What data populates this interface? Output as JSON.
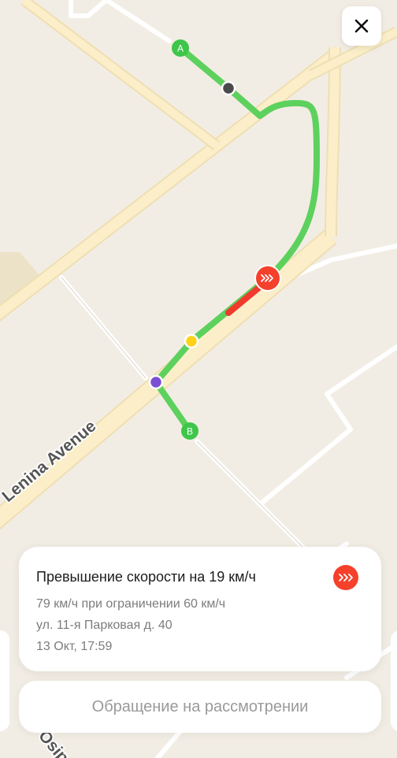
{
  "map": {
    "street_label_lenina": "Lenina Avenue",
    "street_label_osipenko": "Osip",
    "marker_start_label": "A",
    "marker_end_label": "B",
    "route_color": "#5dd15d",
    "speeding_color": "#f03a2e"
  },
  "close_icon": "close-icon",
  "violation_card": {
    "title": "Превышение скорости на 19 км/ч",
    "speed_detail": "79 км/ч при ограничении 60 км/ч",
    "address": "ул. 11-я Парковая д. 40",
    "datetime": "13 Окт, 17:59",
    "badge_icon": "speed-chevrons-icon"
  },
  "appeal_status": {
    "label": "Обращение на рассмотрении"
  }
}
